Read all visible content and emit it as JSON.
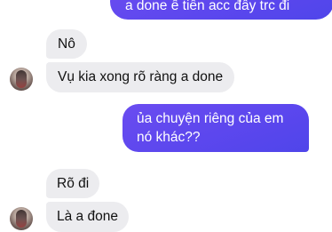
{
  "conversation": {
    "messages": [
      {
        "direction": "outgoing",
        "text": "a done ế tiền acc đầy trc đi"
      },
      {
        "direction": "incoming",
        "text": "Nô"
      },
      {
        "direction": "incoming",
        "text": "Vụ kia xong rõ ràng a done"
      },
      {
        "direction": "outgoing",
        "text": "ủa chuyện riêng của em nó khác??"
      },
      {
        "direction": "incoming",
        "text": "Rõ đi"
      },
      {
        "direction": "incoming",
        "text": "Là a đone"
      }
    ]
  },
  "colors": {
    "incoming_bubble": "#ececef",
    "outgoing_bubble": "#5c47ee",
    "background": "#ffffff"
  }
}
